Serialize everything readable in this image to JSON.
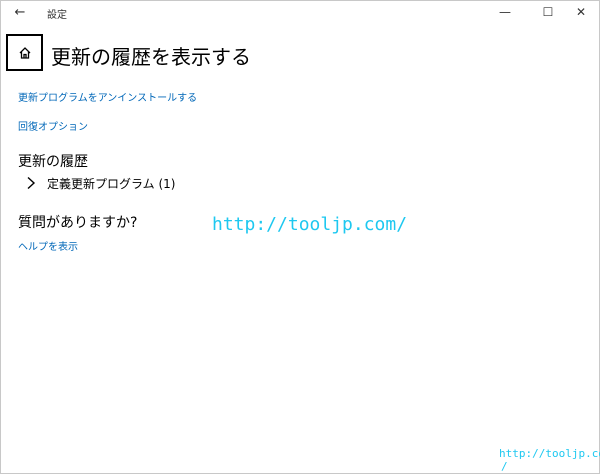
{
  "window": {
    "title": "設定",
    "back_glyph": "←",
    "minimize_glyph": "—",
    "maximize_glyph": "☐",
    "close_glyph": "✕"
  },
  "page": {
    "title": "更新の履歴を表示する",
    "home_icon": "home-icon"
  },
  "links": {
    "uninstall": "更新プログラムをアンインストールする",
    "recovery": "回復オプション"
  },
  "history": {
    "title": "更新の履歴",
    "groups": [
      {
        "label": "定義更新プログラム (1)",
        "expanded": false
      }
    ]
  },
  "help": {
    "title": "質問がありますか?",
    "link": "ヘルプを表示"
  },
  "watermark": {
    "main": "http://tooljp.com/",
    "corner": "http://tooljp.com",
    "corner_slash": "/"
  },
  "colors": {
    "link": "#0067b8",
    "watermark": "#1ec8f0"
  }
}
